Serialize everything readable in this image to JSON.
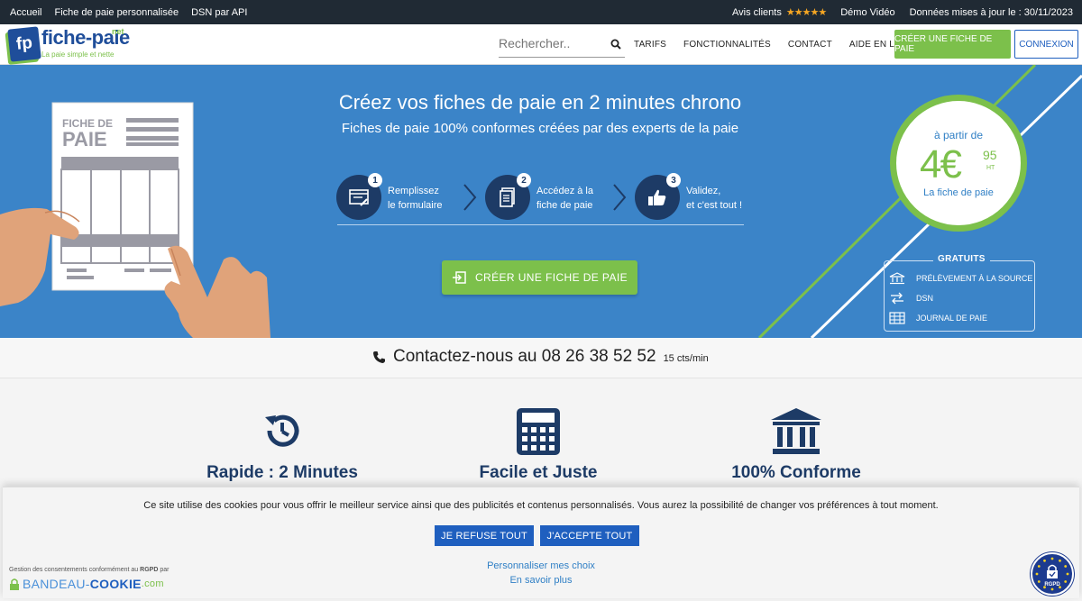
{
  "topbar": {
    "links": [
      "Accueil",
      "Fiche de paie personnalisée",
      "DSN par API"
    ],
    "reviews_label": "Avis clients",
    "stars": "★★★★★",
    "demo_label": "Démo Vidéo",
    "updated_label": "Données mises à jour le : 30/11/2023"
  },
  "header": {
    "logo_fp": "fp",
    "logo_name": "fiche-paie",
    "logo_net": "net",
    "logo_tagline": "La paie simple et nette",
    "search_placeholder": "Rechercher..",
    "nav": [
      "TARIFS",
      "FONCTIONNALITÉS",
      "CONTACT",
      "AIDE EN LIGNE"
    ],
    "create_button": "CRÉER UNE FICHE DE PAIE",
    "login_button": "CONNEXION"
  },
  "hero": {
    "title": "Créez vos fiches de paie en 2 minutes chrono",
    "subtitle": "Fiches de paie 100% conformes créées par des experts de la paie",
    "payslip_title_1": "FICHE DE",
    "payslip_title_2": "PAIE",
    "steps": [
      {
        "num": "1",
        "line1": "Remplissez",
        "line2": "le formulaire",
        "icon": "form-icon"
      },
      {
        "num": "2",
        "line1": "Accédez à la",
        "line2": "fiche de paie",
        "icon": "document-icon"
      },
      {
        "num": "3",
        "line1": "Validez,",
        "line2": "et c'est tout !",
        "icon": "thumbs-up-icon"
      }
    ],
    "cta_button": "CRÉER UNE FICHE DE PAIE",
    "price": {
      "from": "à partir de",
      "euros": "4€",
      "cents": "95",
      "tax": "HT",
      "per": "La fiche de paie"
    },
    "free": {
      "title": "GRATUITS",
      "items": [
        "PRÉLÈVEMENT À LA SOURCE",
        "DSN",
        "JOURNAL DE PAIE"
      ]
    }
  },
  "contact": {
    "text": "Contactez-nous au 08 26 38 52 52",
    "cost": "15 cts/min"
  },
  "features": [
    {
      "title": "Rapide : 2 Minutes",
      "icon": "clock-history-icon"
    },
    {
      "title": "Facile et Juste",
      "icon": "calculator-icon"
    },
    {
      "title": "100% Conforme",
      "icon": "bank-building-icon"
    }
  ],
  "cookie": {
    "message": "Ce site utilise des cookies pour vous offrir le meilleur service ainsi que des publicités et contenus personnalisés. Vous aurez la possibilité de changer vos préférences à tout moment.",
    "refuse": "JE REFUSE TOUT",
    "accept": "J'ACCEPTE TOUT",
    "customize": "Personnaliser mes choix",
    "learn_more": "En savoir plus",
    "gdpr_note_prefix": "Gestion des consentements conformément au",
    "gdpr_note_bold": "RGPD",
    "gdpr_note_suffix": "par",
    "bandeau_1": "BANDEAU-",
    "bandeau_2": "COOKIE",
    "bandeau_3": ".com",
    "rgpd_badge": "RGPD"
  },
  "colors": {
    "hero_blue": "#3b84c8",
    "accent_green": "#7cc04b",
    "dark_navy": "#1d3b66",
    "button_blue": "#1f5fbf"
  }
}
